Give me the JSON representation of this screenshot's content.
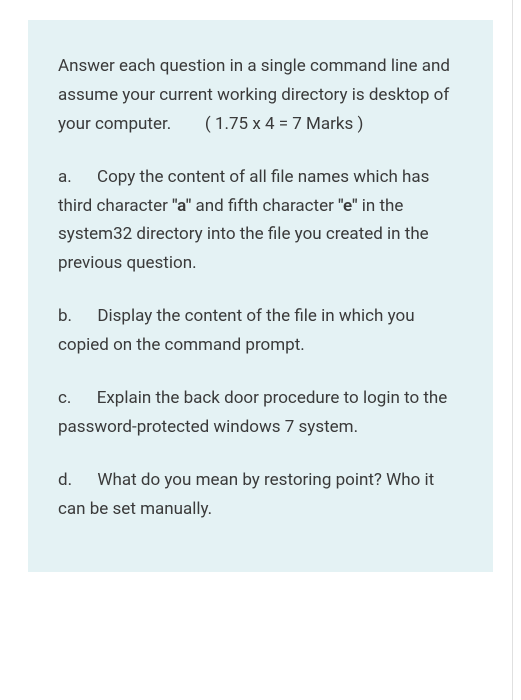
{
  "instruction": {
    "text_pre": "Answer each question in a single command line and assume your current working directory is desktop of your computer.",
    "marks_spacer": "        ",
    "marks": "( 1.75 x 4 = 7 Marks )"
  },
  "items": [
    {
      "label": "a.",
      "spacer": "      ",
      "segments": [
        {
          "text": "Copy the content of all file names which has third character ",
          "bold": false
        },
        {
          "text": "\"a\"",
          "bold": true
        },
        {
          "text": " and fifth character ",
          "bold": false
        },
        {
          "text": "\"e\"",
          "bold": true
        },
        {
          "text": " in the system32 directory into the file you created in the previous question.",
          "bold": false
        }
      ]
    },
    {
      "label": "b.",
      "spacer": "      ",
      "segments": [
        {
          "text": "Display the content of the file in which you copied on the command prompt.",
          "bold": false
        }
      ]
    },
    {
      "label": "c.",
      "spacer": "      ",
      "segments": [
        {
          "text": "Explain the back door procedure to login to the password-protected windows 7 system.",
          "bold": false
        }
      ]
    },
    {
      "label": "d.",
      "spacer": "      ",
      "segments": [
        {
          "text": "What do you mean by restoring point? Who it can be set manually.",
          "bold": false
        }
      ]
    }
  ]
}
